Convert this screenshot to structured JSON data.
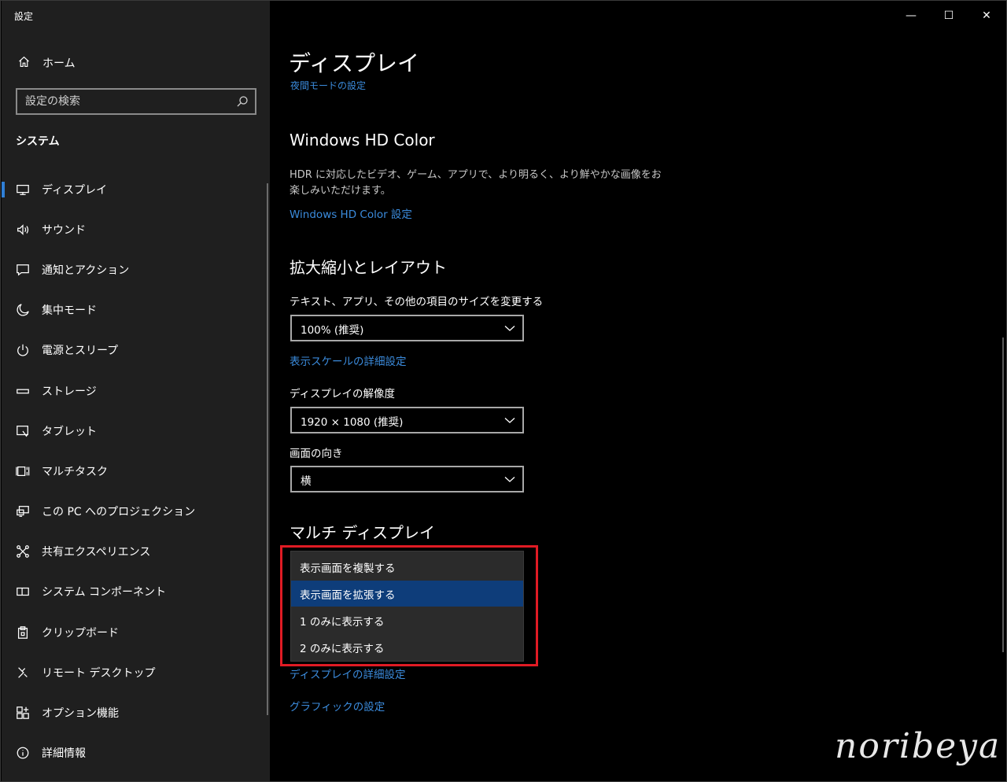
{
  "window": {
    "title": "設定",
    "controls": {
      "minimize": "—",
      "maximize": "☐",
      "close": "✕"
    }
  },
  "sidebar": {
    "home_label": "ホーム",
    "search": {
      "placeholder": "設定の検索"
    },
    "section_label": "システム",
    "items": [
      {
        "label": "ディスプレイ",
        "icon": "monitor-icon",
        "active": true
      },
      {
        "label": "サウンド",
        "icon": "speaker-icon"
      },
      {
        "label": "通知とアクション",
        "icon": "message-icon"
      },
      {
        "label": "集中モード",
        "icon": "moon-icon"
      },
      {
        "label": "電源とスリープ",
        "icon": "power-icon"
      },
      {
        "label": "ストレージ",
        "icon": "storage-icon"
      },
      {
        "label": "タブレット",
        "icon": "tablet-icon"
      },
      {
        "label": "マルチタスク",
        "icon": "multitask-icon"
      },
      {
        "label": "この PC へのプロジェクション",
        "icon": "projection-icon"
      },
      {
        "label": "共有エクスペリエンス",
        "icon": "shared-icon"
      },
      {
        "label": "システム コンポーネント",
        "icon": "components-icon"
      },
      {
        "label": "クリップボード",
        "icon": "clipboard-icon"
      },
      {
        "label": "リモート デスクトップ",
        "icon": "remote-icon"
      },
      {
        "label": "オプション機能",
        "icon": "grid-plus-icon"
      },
      {
        "label": "詳細情報",
        "icon": "info-icon"
      }
    ]
  },
  "main": {
    "title": "ディスプレイ",
    "night_mode_link": "夜間モードの設定",
    "hdr": {
      "title": "Windows HD Color",
      "description": "HDR に対応したビデオ、ゲーム、アプリで、より明るく、より鮮やかな画像をお楽しみいただけます。",
      "link": "Windows HD Color 設定"
    },
    "scale_layout": {
      "title": "拡大縮小とレイアウト",
      "scale_label": "テキスト、アプリ、その他の項目のサイズを変更する",
      "scale_value": "100% (推奨)",
      "advanced_scale_link": "表示スケールの詳細設定",
      "resolution_label": "ディスプレイの解像度",
      "resolution_value": "1920 × 1080 (推奨)",
      "orientation_label": "画面の向き",
      "orientation_value": "横"
    },
    "multi_display": {
      "title": "マルチ ディスプレイ",
      "options": [
        {
          "label": "表示画面を複製する"
        },
        {
          "label": "表示画面を拡張する",
          "selected": true
        },
        {
          "label": "1 のみに表示する"
        },
        {
          "label": "2 のみに表示する"
        }
      ],
      "advanced_link": "ディスプレイの詳細設定",
      "graphics_link": "グラフィックの設定"
    }
  },
  "colors": {
    "accent": "#3b8bdc",
    "selected": "#0e3d7a",
    "highlight": "#e01b24",
    "sidebar_bg": "#1f1f1f"
  },
  "watermark": "noribeya"
}
